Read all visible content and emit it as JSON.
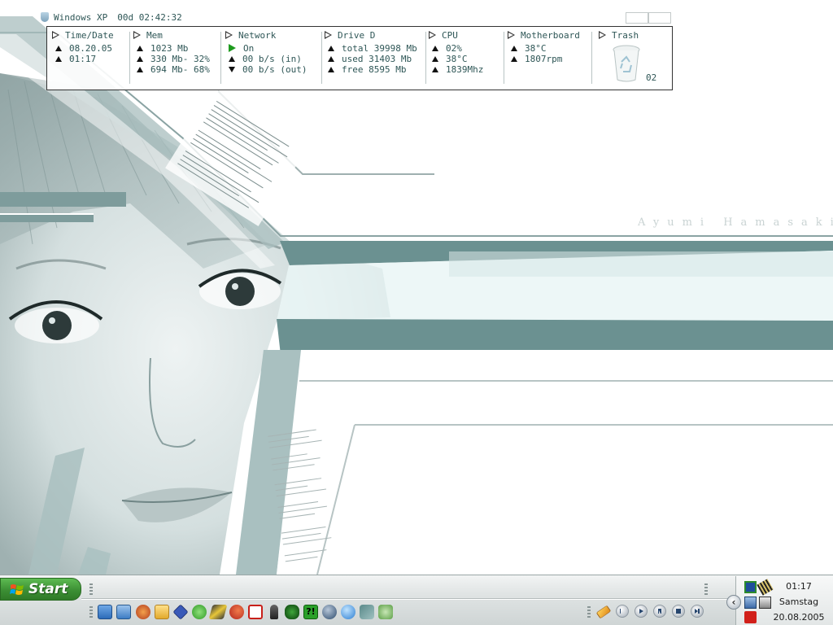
{
  "wallpaper": {
    "caption": "Ayumi Hamasaki",
    "accent_color": "#6b9191"
  },
  "widget": {
    "os_label": "Windows XP",
    "uptime": "00d 02:42:32",
    "columns": [
      {
        "id": "time",
        "title": "Time/Date",
        "rows": [
          {
            "text": "08.20.05",
            "icon": "arrow-up-icon"
          },
          {
            "text": "01:17",
            "icon": "arrow-up-icon"
          }
        ]
      },
      {
        "id": "mem",
        "title": "Mem",
        "rows": [
          {
            "text": "1023 Mb",
            "icon": "arrow-up-icon"
          },
          {
            "text": "330 Mb- 32%",
            "icon": "arrow-up-icon"
          },
          {
            "text": "694 Mb- 68%",
            "icon": "arrow-up-icon"
          }
        ]
      },
      {
        "id": "network",
        "title": "Network",
        "rows": [
          {
            "text": "On",
            "icon": "play-icon"
          },
          {
            "text": "00 b/s (in)",
            "icon": "arrow-up-icon"
          },
          {
            "text": "00 b/s (out)",
            "icon": "arrow-down-icon"
          }
        ]
      },
      {
        "id": "drive",
        "title": "Drive D",
        "rows": [
          {
            "text": "total 39998 Mb",
            "icon": "arrow-up-icon"
          },
          {
            "text": "used 31403 Mb",
            "icon": "arrow-up-icon"
          },
          {
            "text": "free 8595 Mb",
            "icon": "arrow-up-icon"
          }
        ]
      },
      {
        "id": "cpu",
        "title": "CPU",
        "rows": [
          {
            "text": "02%",
            "icon": "arrow-up-icon"
          },
          {
            "text": "38°C",
            "icon": "arrow-up-icon"
          },
          {
            "text": "1839Mhz",
            "icon": "arrow-up-icon"
          }
        ]
      },
      {
        "id": "motherboard",
        "title": "Motherboard",
        "rows": [
          {
            "text": "38°C",
            "icon": "arrow-up-icon"
          },
          {
            "text": "1807rpm",
            "icon": "arrow-up-icon"
          }
        ]
      },
      {
        "id": "trash",
        "title": "Trash",
        "rows": []
      }
    ],
    "trash_count": "02"
  },
  "taskbar": {
    "start_label": "Start",
    "quick_launch": [
      "ie-window-icon",
      "outlook-icon",
      "media-player-icon",
      "folder-icon",
      "diamond-icon",
      "info-icon",
      "book-icon",
      "firefox-icon",
      "acrobat-icon",
      "figure-icon",
      "clover-icon",
      "help-icon",
      "globe-icon",
      "internet-explorer-icon",
      "puzzle-icon",
      "music-icon"
    ],
    "media_controls": [
      "pencil-icon",
      "previous-icon",
      "play-icon",
      "pause-icon",
      "stop-icon",
      "next-icon"
    ],
    "tray": {
      "time": "01:17",
      "weekday": "Samstag",
      "date": "20.08.2005",
      "icons": [
        "network-monitor-icon",
        "chip-icon",
        "network-computer-icon",
        "sound-card-icon",
        "ati-icon"
      ]
    }
  }
}
